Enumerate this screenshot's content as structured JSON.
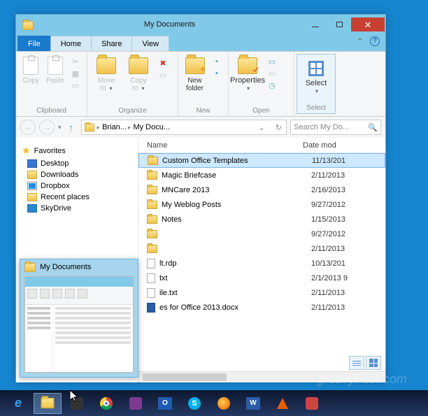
{
  "window": {
    "title": "My Documents",
    "tabs": {
      "file": "File",
      "home": "Home",
      "share": "Share",
      "view": "View"
    }
  },
  "ribbon": {
    "clipboard": {
      "label": "Clipboard",
      "copy": "Copy",
      "paste": "Paste"
    },
    "organize": {
      "label": "Organize",
      "moveto": "Move\nto",
      "copyto": "Copy\nto",
      "delete": "Delete",
      "rename": "Rename"
    },
    "new": {
      "label": "New",
      "newfolder": "New\nfolder"
    },
    "open": {
      "label": "Open",
      "properties": "Properties"
    },
    "select": {
      "label": "Select",
      "select": "Select"
    }
  },
  "address": {
    "crumbs": [
      "Brian...",
      "My Docu..."
    ],
    "search_placeholder": "Search My Do..."
  },
  "nav": {
    "favorites": "Favorites",
    "items": [
      "Desktop",
      "Downloads",
      "Dropbox",
      "Recent places",
      "SkyDrive"
    ]
  },
  "list": {
    "cols": {
      "name": "Name",
      "date": "Date mod"
    },
    "rows": [
      {
        "name": "Custom Office Templates",
        "date": "11/13/201",
        "type": "folder",
        "sel": true
      },
      {
        "name": "Magic Briefcase",
        "date": "2/11/2013",
        "type": "folder"
      },
      {
        "name": "MNCare 2013",
        "date": "2/16/2013",
        "type": "folder"
      },
      {
        "name": "My Weblog Posts",
        "date": "9/27/2012",
        "type": "folder"
      },
      {
        "name": "Notes",
        "date": "1/15/2013",
        "type": "folder"
      },
      {
        "name": "",
        "date": "9/27/2012",
        "type": "folder"
      },
      {
        "name": "",
        "date": "2/11/2013",
        "type": "folder"
      },
      {
        "name": "lt.rdp",
        "date": "10/13/201",
        "type": "doc"
      },
      {
        "name": "txt",
        "date": "2/1/2013 9",
        "type": "doc"
      },
      {
        "name": "ile.txt",
        "date": "2/11/2013",
        "type": "doc"
      },
      {
        "name": "es for Office 2013.docx",
        "date": "2/11/2013",
        "type": "word"
      }
    ]
  },
  "preview": {
    "title": "My Documents"
  },
  "watermark": "groovyPost.com"
}
